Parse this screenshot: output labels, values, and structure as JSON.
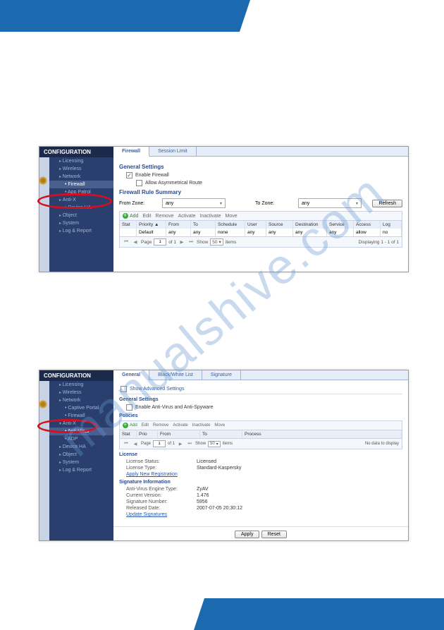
{
  "watermark": "manualshive.com",
  "panel1": {
    "sidebar": {
      "title": "CONFIGURATION",
      "items": [
        {
          "label": "Licensing",
          "type": "ex"
        },
        {
          "label": "Wireless",
          "type": "ex"
        },
        {
          "label": "Network",
          "type": "ex"
        },
        {
          "label": "Firewall",
          "type": "sub",
          "hl": true
        },
        {
          "label": "App Patrol",
          "type": "sub"
        },
        {
          "label": "Anti-X",
          "type": "ex"
        },
        {
          "label": "Device HA",
          "type": "sub"
        },
        {
          "label": "Object",
          "type": "ex"
        },
        {
          "label": "System",
          "type": "ex"
        },
        {
          "label": "Log & Report",
          "type": "ex"
        }
      ]
    },
    "tabs": [
      {
        "label": "Firewall",
        "active": true
      },
      {
        "label": "Session Limit"
      }
    ],
    "general": {
      "section": "General Settings",
      "enable": "Enable Firewall",
      "asym": "Allow Asymmetrical Route"
    },
    "summary": {
      "section": "Firewall Rule Summary",
      "from": "From Zone:",
      "to": "To Zone:",
      "zone_val": "any",
      "refresh": "Refresh",
      "toolbar": {
        "add": "Add",
        "edit": "Edit",
        "remove": "Remove",
        "activate": "Activate",
        "inactivate": "Inactivate",
        "move": "Move"
      },
      "cols": [
        "Stat",
        "Priority ▲",
        "From",
        "To",
        "Schedule",
        "User",
        "Source",
        "Destination",
        "Service",
        "Access",
        "Log"
      ],
      "row": [
        "",
        "Default",
        "any",
        "any",
        "none",
        "any",
        "any",
        "any",
        "any",
        "allow",
        "no"
      ],
      "pager": {
        "page_lbl": "Page",
        "of": "of 1",
        "show": "Show",
        "items": "items",
        "display": "Displaying 1 - 1 of 1",
        "pg": "1",
        "sz": "50"
      }
    }
  },
  "panel2": {
    "sidebar": {
      "title": "CONFIGURATION",
      "items": [
        {
          "label": "Licensing",
          "type": "ex"
        },
        {
          "label": "Wireless",
          "type": "ex"
        },
        {
          "label": "Network",
          "type": "ex"
        },
        {
          "label": "Captive Portal",
          "type": "sub"
        },
        {
          "label": "Firewall",
          "type": "sub"
        },
        {
          "label": "Anti-X",
          "type": "ex",
          "open": true
        },
        {
          "label": "Anti-Virus",
          "type": "sub",
          "hl": true
        },
        {
          "label": "ADP",
          "type": "sub"
        },
        {
          "label": "Device HA",
          "type": "ex"
        },
        {
          "label": "Object",
          "type": "ex"
        },
        {
          "label": "System",
          "type": "ex"
        },
        {
          "label": "Log & Report",
          "type": "ex"
        }
      ]
    },
    "tabs": [
      {
        "label": "General",
        "active": true
      },
      {
        "label": "Black/White List"
      },
      {
        "label": "Signature"
      }
    ],
    "adv": "Show Advanced Settings",
    "general": {
      "section": "General Settings",
      "enable": "Enable Anti-Virus and Anti-Spyware"
    },
    "policies": {
      "section": "Policies",
      "toolbar": {
        "add": "Add",
        "edit": "Edit",
        "remove": "Remove",
        "activate": "Activate",
        "inactivate": "Inactivate",
        "move": "Move"
      },
      "cols": [
        "Stat",
        "Prio",
        "From",
        "To",
        "Process"
      ],
      "pager": {
        "page_lbl": "Page",
        "of": "of 1",
        "show": "Show",
        "items": "items",
        "display": "No data to display",
        "pg": "1",
        "sz": "50"
      }
    },
    "license": {
      "section": "License",
      "status_k": "License Status:",
      "status_v": "Licensed",
      "type_k": "License Type:",
      "type_v": "Standard-Kaspersky",
      "link": "Apply New Registration"
    },
    "sig": {
      "section": "Signature Information",
      "engine_k": "Anti-Virus Engine Type:",
      "engine_v": "ZyAV",
      "ver_k": "Current Version:",
      "ver_v": "1.476",
      "num_k": "Signature Number:",
      "num_v": "5956",
      "rel_k": "Released Date:",
      "rel_v": "2007-07-05 20:30:12",
      "link": "Update Signatures"
    },
    "buttons": {
      "apply": "Apply",
      "reset": "Reset"
    }
  }
}
